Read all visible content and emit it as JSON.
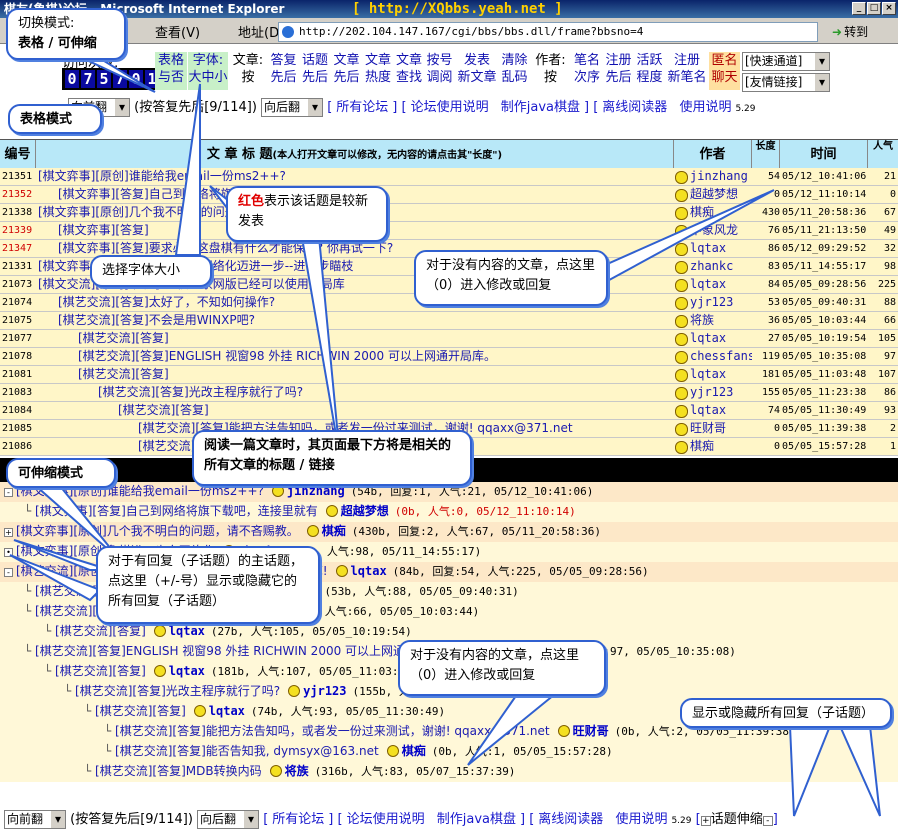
{
  "window": {
    "title": "棋友(象棋)论坛 - Microsoft Internet Explorer",
    "banner": "[ http://XQbbs.yeah.net ]"
  },
  "menubar": {
    "view": "查看(V)",
    "address_label": "地址(D)",
    "address": "http://202.104.147.167/cgi/bbs/bbs.dll/frame?bbsno=4",
    "go": "转到"
  },
  "counter": {
    "label": "访问次数:",
    "digits": [
      "0",
      "7",
      "5",
      "7",
      "0",
      "1"
    ]
  },
  "controls": [
    {
      "id": "ctrl-table-or-tree",
      "label": "表格\n与否"
    },
    {
      "id": "ctrl-font",
      "label": "字体:\n大中小"
    },
    {
      "id": "ctrl-sort-label",
      "label": "文章:\n按"
    },
    {
      "id": "ctrl-by-reply",
      "label": "答复\n先后"
    },
    {
      "id": "ctrl-by-topic",
      "label": "话题\n先后"
    },
    {
      "id": "ctrl-by-article",
      "label": "文章\n先后"
    },
    {
      "id": "ctrl-by-heat",
      "label": "文章\n热度"
    },
    {
      "id": "ctrl-search",
      "label": "文章\n查找"
    },
    {
      "id": "ctrl-account",
      "label": "按号\n调阅"
    },
    {
      "id": "ctrl-post",
      "label": "发表\n新文章"
    },
    {
      "id": "ctrl-clear",
      "label": "清除\n乱码"
    },
    {
      "id": "ctrl-author-label",
      "label": "作者:\n按"
    },
    {
      "id": "ctrl-pen-order",
      "label": "笔名\n次序"
    },
    {
      "id": "ctrl-reg-order",
      "label": "注册\n先后"
    },
    {
      "id": "ctrl-active",
      "label": "活跃\n程度"
    },
    {
      "id": "ctrl-register",
      "label": "注册\n新笔名"
    },
    {
      "id": "ctrl-anon-chat",
      "label": "匿名\n聊天"
    }
  ],
  "quick_selects": [
    "[快速通道]",
    "[友情链接]"
  ],
  "nav": {
    "prev": "向前翻",
    "page_info": "(按答复先后[9/114])",
    "next": "向后翻",
    "all_forums": "所有论坛",
    "forum_help": "论坛使用说明",
    "java_board": "制作java棋盘",
    "offline_reader": "离线阅读器",
    "usage": "使用说明",
    "usage_ver": "5.29",
    "toggle_replies": "话题伸缩"
  },
  "table": {
    "headers": {
      "num": "编号",
      "title": "文 章 标 题",
      "title_note": "(本人打开文章可以修改，无内容的请点击其\"长度\")",
      "author": "作者",
      "length": "长度",
      "time": "时间",
      "pop": "人气"
    },
    "rows": [
      {
        "num": "21351",
        "red": false,
        "indent": 0,
        "title": "[棋文弈事][原创]谁能给我email一份ms2++?",
        "author": "jinzhang",
        "len": "54",
        "time": "05/12_10:41:06",
        "pop": "21"
      },
      {
        "num": "21352",
        "red": true,
        "indent": 1,
        "title": "[棋文弈事][答复]自己到网络将旗下载吧，连接里就有",
        "author": "超越梦想",
        "len": "0",
        "time": "05/12_11:10:14",
        "pop": "0"
      },
      {
        "num": "21338",
        "red": false,
        "indent": 0,
        "title": "[棋文弈事][原创]几个我不明白的问题，请不吝赐教。",
        "author": "棋痴",
        "len": "430",
        "time": "05/11_20:58:36",
        "pop": "67"
      },
      {
        "num": "21339",
        "red": true,
        "indent": 1,
        "title": "[棋文弈事][答复]",
        "author": "中象风龙",
        "len": "76",
        "time": "05/11_21:13:50",
        "pop": "49"
      },
      {
        "num": "21347",
        "red": true,
        "indent": 1,
        "title": "[棋文弈事][答复]要求必须这盘棋有什么才能保存? 你再试一下?",
        "author": "lqtax",
        "len": "86",
        "time": "05/12_09:29:52",
        "pop": "32"
      },
      {
        "num": "21331",
        "red": false,
        "indent": 0,
        "title": "[棋文弈事][原创]象棋进一步向网络化迈进一步--进一步瞄枝",
        "author": "zhankc",
        "len": "83",
        "time": "05/11_14:55:17",
        "pop": "98"
      },
      {
        "num": "21073",
        "red": false,
        "indent": 0,
        "title": "[棋文交流][原创]下载了象棋世家网版已经可以使用开局库",
        "author": "lqtax",
        "len": "84",
        "time": "05/05_09:28:56",
        "pop": "225"
      },
      {
        "num": "21074",
        "red": false,
        "indent": 1,
        "title": "[棋艺交流][答复]太好了，不知如何操作?",
        "author": "yjr123",
        "len": "53",
        "time": "05/05_09:40:31",
        "pop": "88"
      },
      {
        "num": "21075",
        "red": false,
        "indent": 1,
        "title": "[棋艺交流][答复]不会是用WINXP吧?",
        "author": "将族",
        "len": "36",
        "time": "05/05_10:03:44",
        "pop": "66"
      },
      {
        "num": "21077",
        "red": false,
        "indent": 2,
        "title": "[棋艺交流][答复]",
        "author": "lqtax",
        "len": "27",
        "time": "05/05_10:19:54",
        "pop": "105"
      },
      {
        "num": "21078",
        "red": false,
        "indent": 2,
        "title": "[棋艺交流][答复]ENGLISH 视窗98 外挂 RICHWIN 2000 可以上网通开局库。",
        "author": "chessfans",
        "len": "119",
        "time": "05/05_10:35:08",
        "pop": "97"
      },
      {
        "num": "21081",
        "red": false,
        "indent": 2,
        "title": "[棋艺交流][答复]",
        "author": "lqtax",
        "len": "181",
        "time": "05/05_11:03:48",
        "pop": "107"
      },
      {
        "num": "21083",
        "red": false,
        "indent": 3,
        "title": "[棋艺交流][答复]光改主程序就行了吗?",
        "author": "yjr123",
        "len": "155",
        "time": "05/05_11:23:38",
        "pop": "86"
      },
      {
        "num": "21084",
        "red": false,
        "indent": 4,
        "title": "[棋艺交流][答复]",
        "author": "lqtax",
        "len": "74",
        "time": "05/05_11:30:49",
        "pop": "93"
      },
      {
        "num": "21085",
        "red": false,
        "indent": 5,
        "title": "[棋艺交流][答复]能把方法告知吗，或者发一份过来测试，谢谢! qqaxx@371.net",
        "author": "旺财哥",
        "len": "0",
        "time": "05/05_11:39:38",
        "pop": "2"
      },
      {
        "num": "21086",
        "red": false,
        "indent": 5,
        "title": "[棋艺交流][答复]能否告知我，dymsyx@163.net",
        "author": "棋痴",
        "len": "0",
        "time": "05/05_15:57:28",
        "pop": "1"
      }
    ]
  },
  "tree": {
    "rows": [
      {
        "style": "a",
        "pm": "-",
        "indent": 0,
        "title": "[棋文弈事][原创]谁能给我email一份ms2++?",
        "user": "jinzhang",
        "meta": "(54b, 回复:1, 人气:21, 05/12_10:41:06)",
        "red": false
      },
      {
        "style": "b",
        "pm": "",
        "indent": 1,
        "title": "[棋文弈事][答复]自己到网络将旗下载吧，连接里就有",
        "user": "超越梦想",
        "meta": "(0b, 人气:0, 05/12_11:10:14)",
        "red": true
      },
      {
        "style": "a",
        "pm": "+",
        "indent": 0,
        "title": "[棋文弈事][原创]几个我不明白的问题，请不吝赐教。",
        "user": "棋痴",
        "meta": "(430b, 回复:2, 人气:67, 05/11_20:58:36)",
        "red": false
      },
      {
        "style": "b",
        "pm": "•",
        "indent": 0,
        "title": "[棋文弈事][原创]象棋进一步向网络化",
        "user": "zhankc",
        "meta": "(83b, 人气:98, 05/11_14:55:17)",
        "red": false
      },
      {
        "style": "a",
        "pm": "-",
        "indent": 0,
        "title": "[棋艺交流][原创]下载了象棋世家网版已经可以使用开局库!",
        "user": "lqtax",
        "meta": "(84b, 回复:54, 人气:225, 05/05_09:28:56)",
        "red": false
      },
      {
        "style": "b",
        "pm": "",
        "indent": 1,
        "title": "[棋艺交流][答复]太好了，不知如何操作?",
        "user": "yjr123",
        "meta": "(53b, 人气:88, 05/05_09:40:31)",
        "red": false
      },
      {
        "style": "b",
        "pm": "",
        "indent": 1,
        "title": "[棋艺交流][答复]不会是用WINXP吧?",
        "user": "将族",
        "meta": "(36b, 人气:66, 05/05_10:03:44)",
        "red": false
      },
      {
        "style": "b",
        "pm": "",
        "indent": 2,
        "title": "[棋艺交流][答复]",
        "user": "lqtax",
        "meta": "(27b, 人气:105, 05/05_10:19:54)",
        "red": false
      },
      {
        "style": "b",
        "pm": "",
        "indent": 1,
        "title": "[棋艺交流][答复]ENGLISH 视窗98 外挂 RICHWIN 2000 可以上网通开局库",
        "user": "chessfans",
        "meta": "(119b, 人气:97, 05/05_10:35:08)",
        "red": false
      },
      {
        "style": "b",
        "pm": "",
        "indent": 2,
        "title": "[棋艺交流][答复]",
        "user": "lqtax",
        "meta": "(181b, 人气:107, 05/05_11:03:48)",
        "red": false
      },
      {
        "style": "b",
        "pm": "",
        "indent": 3,
        "title": "[棋艺交流][答复]光改主程序就行了吗?",
        "user": "yjr123",
        "meta": "(155b, 人气:86, 05/05_11:23:38)",
        "red": false
      },
      {
        "style": "b",
        "pm": "",
        "indent": 4,
        "title": "[棋艺交流][答复]",
        "user": "lqtax",
        "meta": "(74b, 人气:93, 05/05_11:30:49)",
        "red": false
      },
      {
        "style": "b",
        "pm": "",
        "indent": 5,
        "title": "[棋艺交流][答复]能把方法告知吗，或者发一份过来测试，谢谢! qqaxx@371.net",
        "user": "旺财哥",
        "meta": "(0b, 人气:2, 05/05_11:39:38)",
        "red": false
      },
      {
        "style": "b",
        "pm": "",
        "indent": 5,
        "title": "[棋艺交流][答复]能否告知我, dymsyx@163.net",
        "user": "棋痴",
        "meta": "(0b, 人气:1, 05/05_15:57:28)",
        "red": false
      },
      {
        "style": "b",
        "pm": "",
        "indent": 4,
        "title": "[棋艺交流][答复]MDB转换内码",
        "user": "将族",
        "meta": "(316b, 人气:83, 05/07_15:37:39)",
        "red": false
      }
    ]
  },
  "callouts": {
    "mode_switch_title": "切换模式:",
    "mode_switch_body": "表格 / 可伸缩",
    "table_mode": "表格模式",
    "red_title_1": "红色",
    "red_title_2": "表示该话题是较新发表",
    "font_size": "选择字体大小",
    "no_content_1": "对于没有内容的文章，点这里（0）进入修改或回复",
    "related_titles": "阅读一篇文章时，其页面最下方将是相关的所有文章的标题 / 链接",
    "tree_mode": "可伸缩模式",
    "expand_replies": "对于有回复（子话题）的主话题，点这里（+/-号）显示或隐藏它的所有回复（子话题）",
    "no_content_2": "对于没有内容的文章，点这里（0）进入修改或回复",
    "toggle_all": "显示或隐藏所有回复（子话题）"
  }
}
